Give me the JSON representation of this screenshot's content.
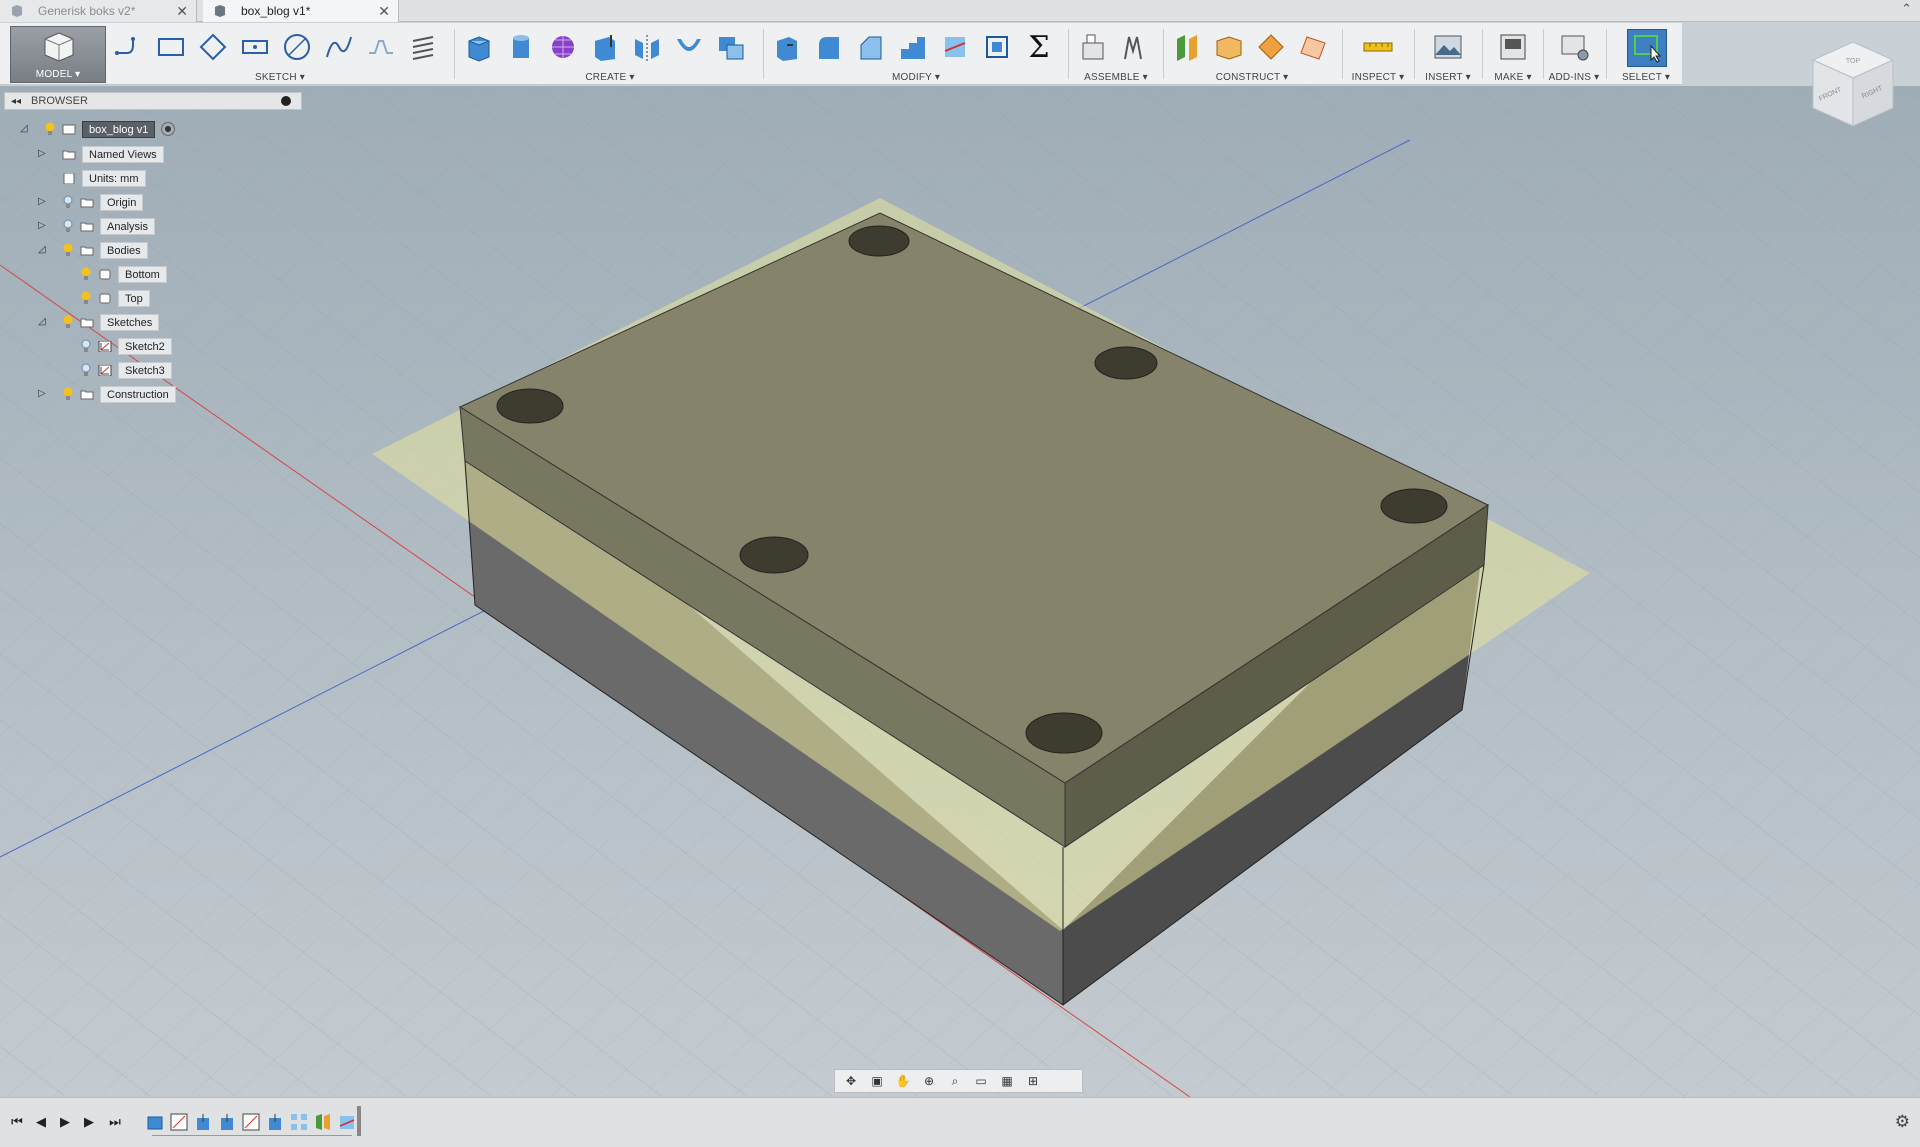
{
  "tabs": [
    {
      "label": "Generisk boks v2*",
      "active": false
    },
    {
      "label": "box_blog v1*",
      "active": true
    }
  ],
  "toolbar": {
    "model_label": "MODEL ▾",
    "sketch_label": "SKETCH ▾",
    "create_label": "CREATE ▾",
    "modify_label": "MODIFY ▾",
    "assemble_label": "ASSEMBLE ▾",
    "construct_label": "CONSTRUCT ▾",
    "inspect_label": "INSPECT ▾",
    "insert_label": "INSERT ▾",
    "make_label": "MAKE ▾",
    "addins_label": "ADD-INS ▾",
    "select_label": "SELECT ▾",
    "sigma": "Σ"
  },
  "browser": {
    "title": "BROWSER",
    "root": "box_blog v1",
    "named_views": "Named Views",
    "units": "Units: mm",
    "origin": "Origin",
    "analysis": "Analysis",
    "bodies": "Bodies",
    "bottom": "Bottom",
    "top": "Top",
    "sketches": "Sketches",
    "sketch2": "Sketch2",
    "sketch3": "Sketch3",
    "construction": "Construction"
  },
  "viewcube": {
    "front": "FRONT",
    "right": "RIGHT",
    "top": "TOP"
  },
  "colors": {
    "plane": "#e6e39a",
    "box_top": "#85846a",
    "accent_select": "#3d7fc1"
  }
}
